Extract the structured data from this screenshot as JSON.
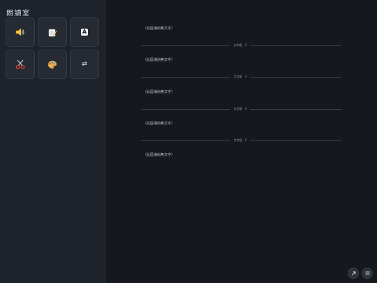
{
  "app": {
    "title": "朗讀室"
  },
  "tools": [
    {
      "name": "speaker"
    },
    {
      "name": "memo"
    },
    {
      "name": "letter-a",
      "glyph": "A"
    },
    {
      "name": "scissors"
    },
    {
      "name": "palette"
    },
    {
      "name": "swap",
      "glyph": "⇄"
    }
  ],
  "document": {
    "paragraphs": [
      "（此區塊尚無文字）",
      "（此區塊尚無文字）",
      "（此區塊尚無文字）",
      "（此區塊尚無文字）",
      "（此區塊尚無文字）"
    ],
    "dividers": [
      "文字區　2",
      "文字區　3",
      "文字區　4",
      "文字區　5"
    ]
  },
  "colors": {
    "background": "#15181d",
    "sidebar": "#1e222b",
    "button": "#252a33"
  }
}
